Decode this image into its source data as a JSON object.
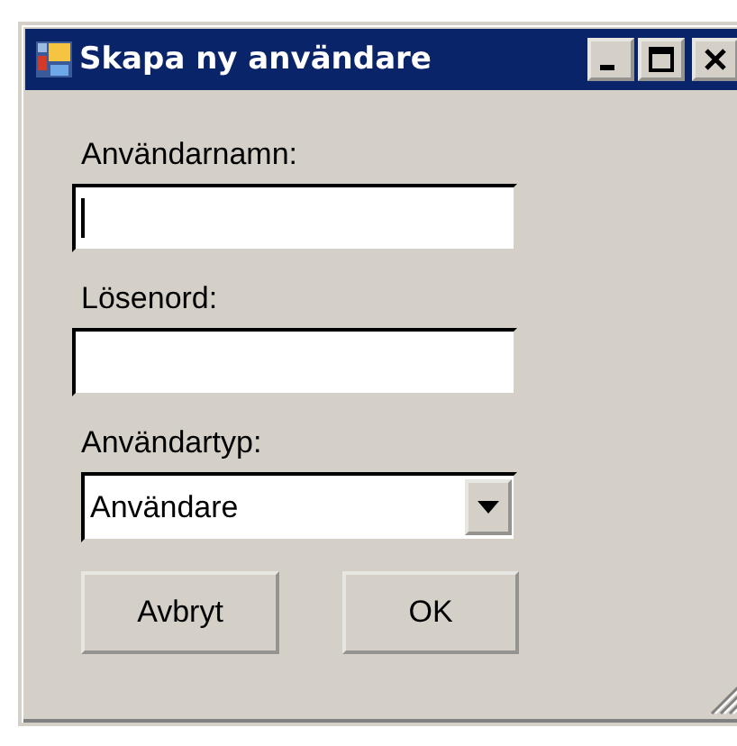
{
  "window": {
    "title": "Skapa ny användare"
  },
  "fields": [
    {
      "label": "Användarnamn:",
      "focused": true
    },
    {
      "label": "Lösenord:"
    }
  ],
  "user_type": {
    "label": "Användartyp:",
    "value": "Användare"
  },
  "buttons": [
    "Avbryt",
    "OK"
  ]
}
